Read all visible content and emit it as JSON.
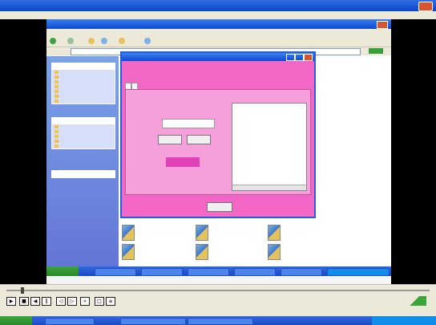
{
  "player": {
    "title": "",
    "menu": [
      "",
      "",
      "",
      "",
      ""
    ],
    "close_label": ""
  },
  "explorer": {
    "title": "",
    "menu": [
      "",
      "",
      "",
      "",
      "",
      ""
    ],
    "panels": [
      {
        "header": "",
        "items": [
          "",
          "",
          "",
          "",
          "",
          "",
          ""
        ]
      },
      {
        "header": "",
        "items": [
          "",
          "",
          "",
          "",
          ""
        ]
      },
      {
        "header": "",
        "items": []
      }
    ],
    "files": [
      "",
      "",
      "",
      "",
      "",
      "",
      "",
      "",
      "",
      "",
      "",
      ""
    ]
  },
  "dialog": {
    "title": "",
    "heading": "",
    "tabs": [
      "",
      ""
    ],
    "field_label": "",
    "field_value": "",
    "buttons": [
      "",
      ""
    ],
    "status": "",
    "list_header": "",
    "exit_label": ""
  },
  "controls": {
    "timecode": ""
  },
  "colors": {
    "dialog_bg": "#f266c6",
    "xp_blue": "#0d4ad1",
    "start_green": "#3aa53a"
  }
}
